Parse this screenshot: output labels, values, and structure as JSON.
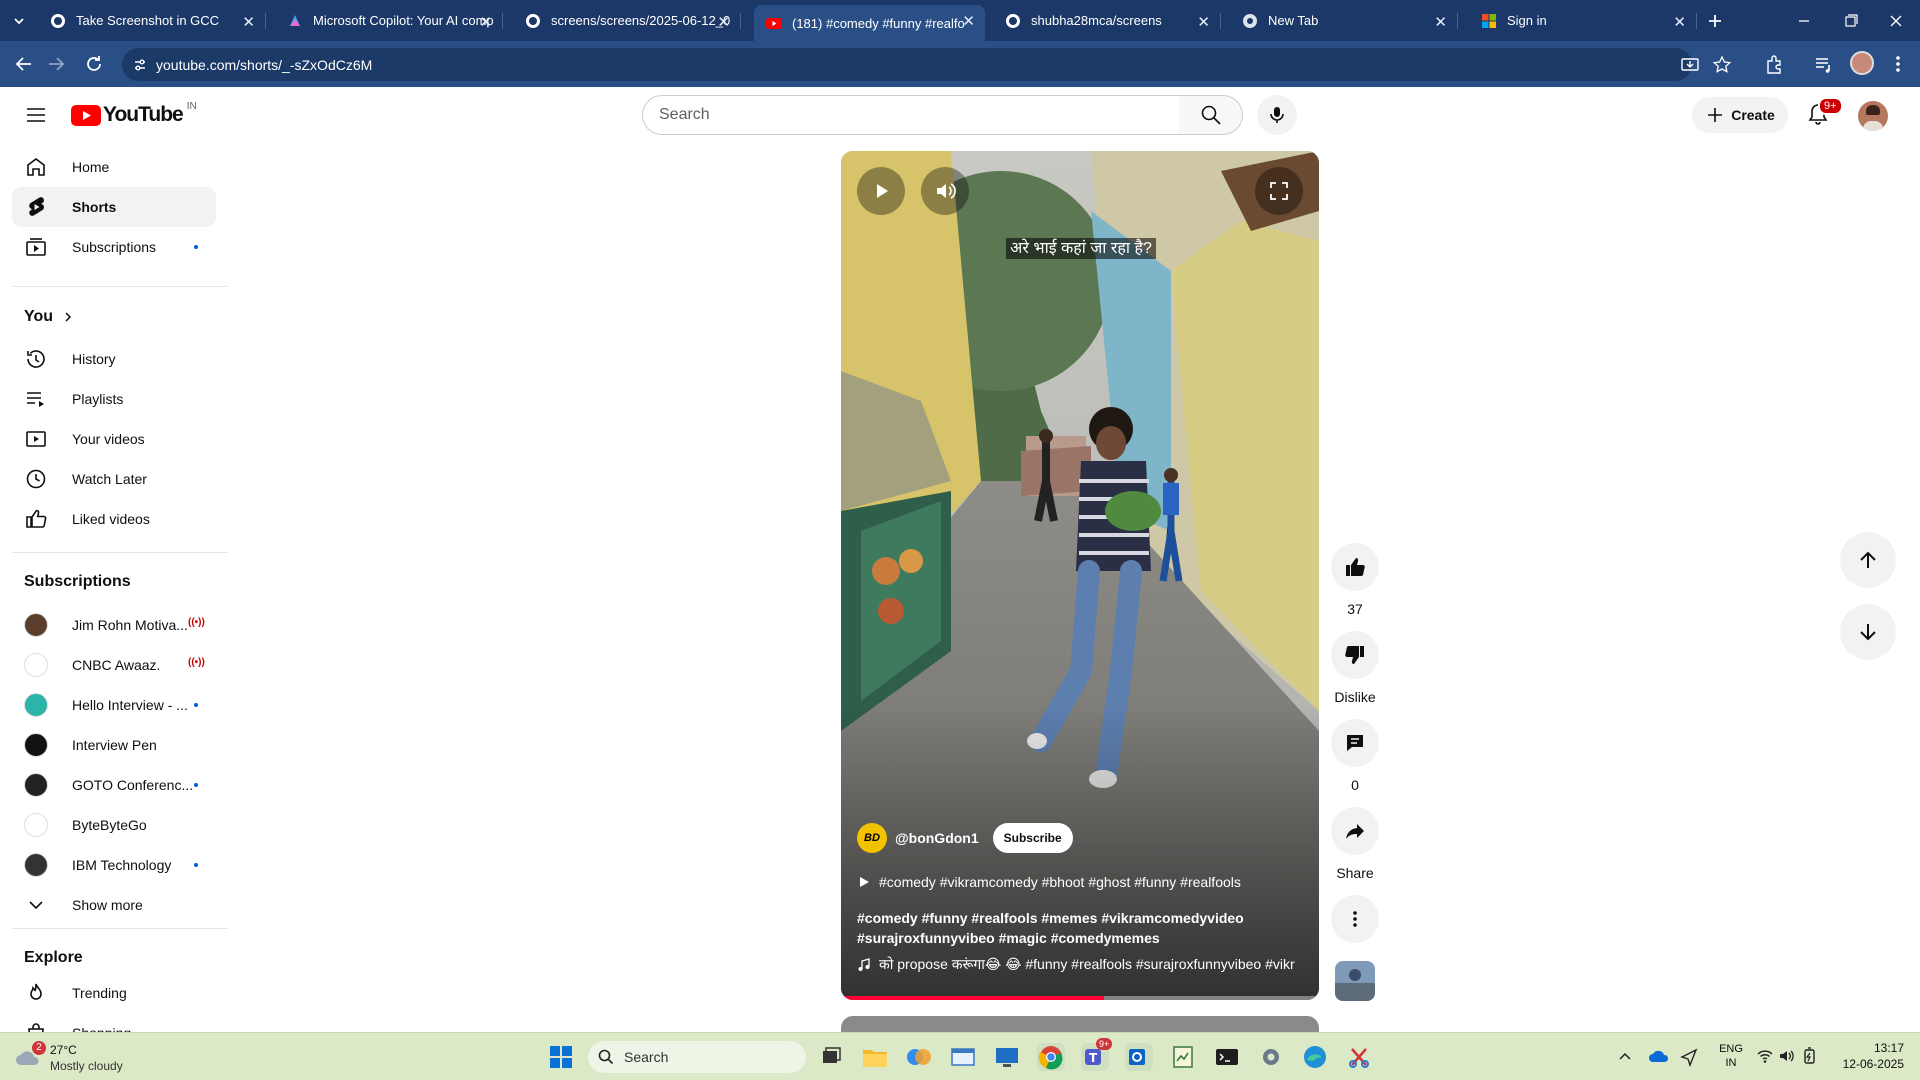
{
  "browser": {
    "tabs": [
      {
        "title": "Take Screenshot in GCC",
        "favicon": "github-icon",
        "active": false
      },
      {
        "title": "Microsoft Copilot: Your AI comp",
        "favicon": "copilot-icon",
        "active": false
      },
      {
        "title": "screens/screens/2025-06-12_0",
        "favicon": "github-icon",
        "active": false
      },
      {
        "title": "(181) #comedy #funny #realfo",
        "favicon": "youtube-icon",
        "active": true
      },
      {
        "title": "shubha28mca/screens",
        "favicon": "github-icon",
        "active": false
      },
      {
        "title": "New Tab",
        "favicon": "chrome-icon",
        "active": false
      },
      {
        "title": "Sign in",
        "favicon": "microsoft-icon",
        "active": false
      }
    ],
    "url": "youtube.com/shorts/_-sZxOdCz6M"
  },
  "youtube": {
    "logo_text": "YouTube",
    "region": "IN",
    "search_placeholder": "Search",
    "create_label": "Create",
    "notification_count": "9+"
  },
  "sidebar": {
    "main": [
      {
        "label": "Home",
        "icon": "home-icon"
      },
      {
        "label": "Shorts",
        "icon": "shorts-icon",
        "selected": true
      },
      {
        "label": "Subscriptions",
        "icon": "subscriptions-icon"
      }
    ],
    "you_header": "You",
    "you_items": [
      {
        "label": "History",
        "icon": "history-icon"
      },
      {
        "label": "Playlists",
        "icon": "playlists-icon"
      },
      {
        "label": "Your videos",
        "icon": "your-videos-icon"
      },
      {
        "label": "Watch Later",
        "icon": "watch-later-icon"
      },
      {
        "label": "Liked videos",
        "icon": "liked-videos-icon"
      }
    ],
    "subscriptions_header": "Subscriptions",
    "subscriptions": [
      {
        "label": "Jim Rohn Motiva...",
        "badge": "live",
        "color": "#5a3e2b"
      },
      {
        "label": "CNBC Awaaz.",
        "badge": "live",
        "color": "#ffffff"
      },
      {
        "label": "Hello Interview - ...",
        "badge": "dot",
        "color": "#2bb5a8"
      },
      {
        "label": "Interview Pen",
        "badge": "",
        "color": "#111111"
      },
      {
        "label": "GOTO Conferenc...",
        "badge": "dot",
        "color": "#222222"
      },
      {
        "label": "ByteByteGo",
        "badge": "",
        "color": "#ffffff"
      },
      {
        "label": "IBM Technology",
        "badge": "dot",
        "color": "#333333"
      }
    ],
    "show_more": "Show more",
    "explore_header": "Explore",
    "explore_items": [
      {
        "label": "Trending",
        "icon": "trending-icon"
      },
      {
        "label": "Shopping",
        "icon": "shopping-icon"
      }
    ]
  },
  "short": {
    "caption": "अरे भाई कहां जा रहा है?",
    "channel": "@bonGdon1",
    "channel_avatar_text": "BD",
    "subscribe_label": "Subscribe",
    "playlist_title": "#comedy #vikramcomedy #bhoot #ghost #funny #realfools",
    "description_line1": "#comedy #funny #realfools #memes #vikramcomedyvideo",
    "description_line2": "#surajroxfunnyvibeo #magic #comedymemes",
    "sound": "को propose करूंगा😂 😂 #funny #realfools #surajroxfunnyvibeo #vikr",
    "progress": 0.55
  },
  "actions": {
    "likes": "37",
    "dislike_label": "Dislike",
    "comments": "0",
    "share_label": "Share"
  },
  "taskbar": {
    "weather_temp": "27°C",
    "weather_desc": "Mostly cloudy",
    "weather_badge": "2",
    "search_label": "Search",
    "teams_badge": "9+",
    "lang_line1": "ENG",
    "lang_line2": "IN",
    "time": "13:17",
    "date": "12-06-2025"
  }
}
